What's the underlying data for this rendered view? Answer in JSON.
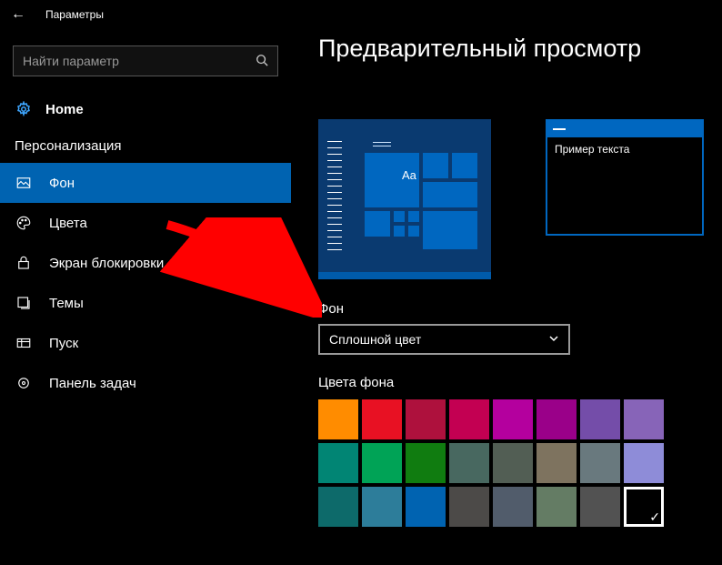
{
  "window": {
    "title": "Параметры"
  },
  "sidebar": {
    "search_placeholder": "Найти параметр",
    "home_label": "Home",
    "section_label": "Персонализация",
    "items": [
      {
        "label": "Фон"
      },
      {
        "label": "Цвета"
      },
      {
        "label": "Экран блокировки"
      },
      {
        "label": "Темы"
      },
      {
        "label": "Пуск"
      },
      {
        "label": "Панель задач"
      }
    ]
  },
  "main": {
    "heading": "Предварительный просмотр",
    "preview_tile_text": "Aa",
    "sample_text": "Пример текста",
    "background_label": "Фон",
    "dropdown_value": "Сплошной цвет",
    "colors_label": "Цвета фона",
    "swatches": [
      [
        "#ff8c00",
        "#e81123",
        "#ae113d",
        "#c30052",
        "#b4009e",
        "#9a0089",
        "#744da9",
        "#8764b8"
      ],
      [
        "#018574",
        "#00a356",
        "#107c10",
        "#486860",
        "#525e54",
        "#7e735f",
        "#69797e",
        "#8e8cd8"
      ],
      [
        "#0d6a6a",
        "#2d7d9a",
        "#0063b1",
        "#4c4a48",
        "#515c6b",
        "#647c64",
        "#525252",
        "#000000"
      ]
    ],
    "selected_swatch": [
      2,
      7
    ]
  }
}
